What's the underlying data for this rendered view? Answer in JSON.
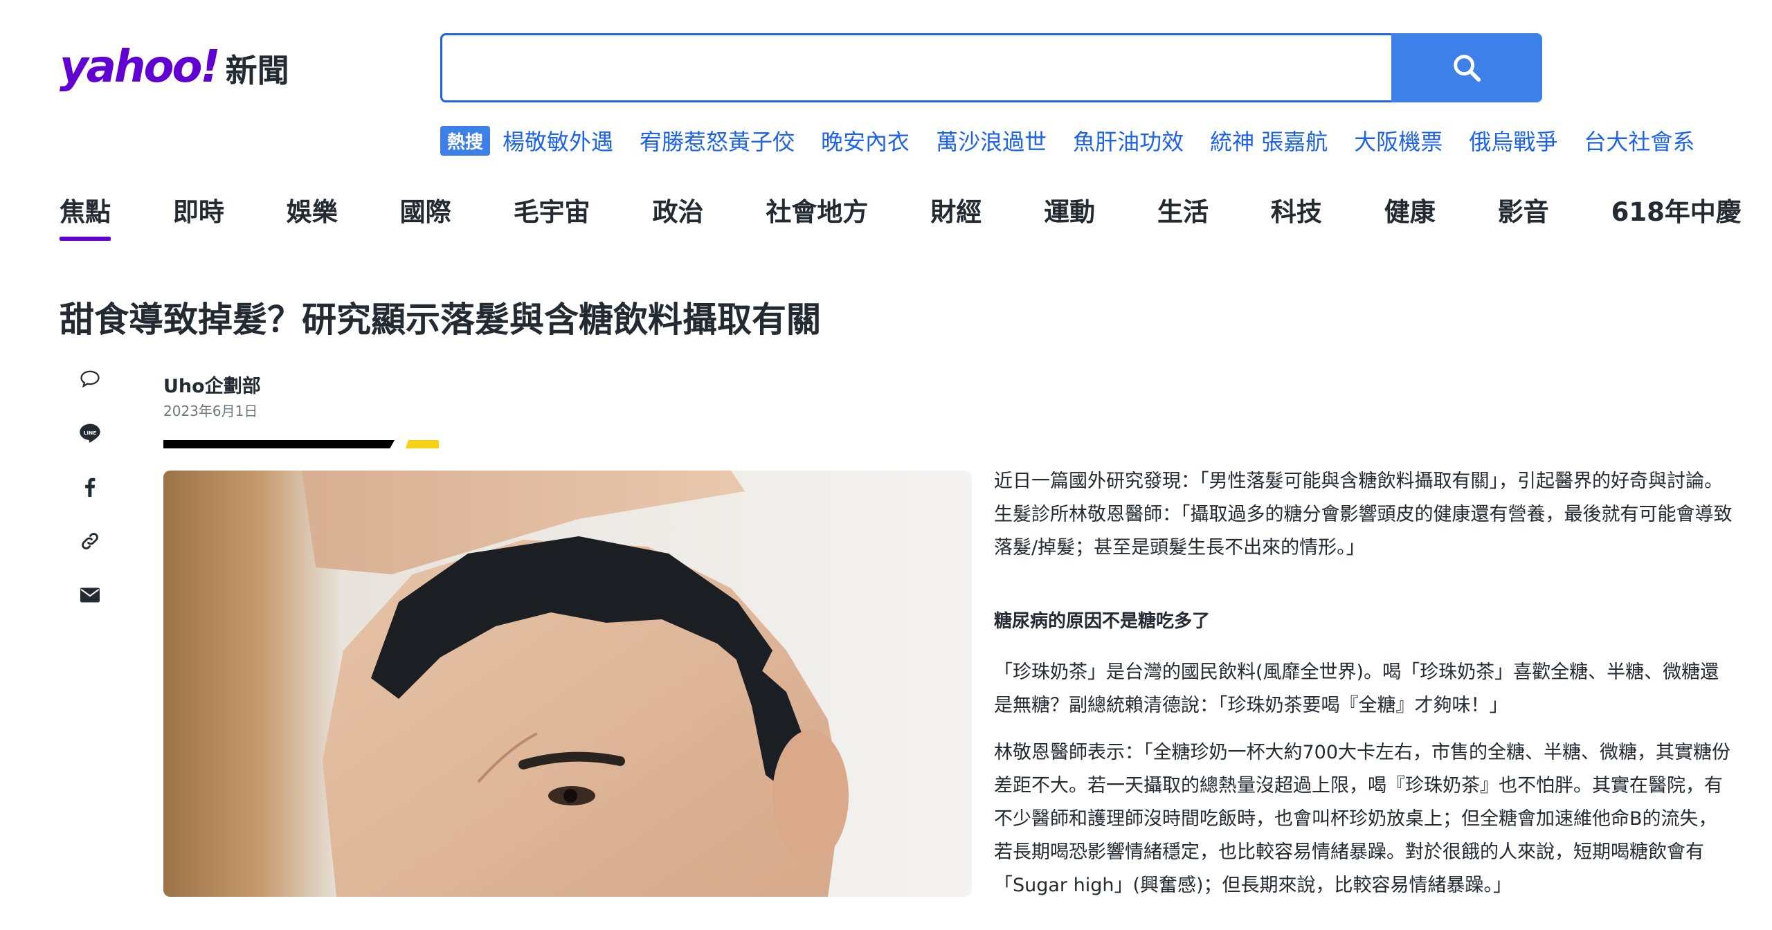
{
  "header": {
    "logo_text": "yahoo!",
    "section_name": "新聞",
    "search": {
      "placeholder": "",
      "value": ""
    },
    "search_icon": "search-icon",
    "trending_badge": "熱搜",
    "trending": [
      "楊敬敏外遇",
      "宥勝惹怒黃子佼",
      "晚安內衣",
      "萬沙浪過世",
      "魚肝油功效",
      "統神 張嘉航",
      "大阪機票",
      "俄烏戰爭",
      "台大社會系"
    ]
  },
  "nav": {
    "items": [
      "焦點",
      "即時",
      "娛樂",
      "國際",
      "毛宇宙",
      "政治",
      "社會地方",
      "財經",
      "運動",
      "生活",
      "科技",
      "健康",
      "影音",
      "618年中慶"
    ],
    "active_index": 0
  },
  "article": {
    "headline": "甜食導致掉髮？研究顯示落髮與含糖飲料攝取有關",
    "author": "Uho企劃部",
    "date": "2023年6月1日",
    "share_icons": [
      "comment-icon",
      "line-icon",
      "facebook-icon",
      "link-icon",
      "mail-icon"
    ],
    "paragraph_1": "近日一篇國外研究發現：「男性落髮可能與含糖飲料攝取有關」，引起醫界的好奇與討論。生髮診所林敬恩醫師：「攝取過多的糖分會影響頭皮的健康還有營養，最後就有可能會導致落髮/掉髮；甚至是頭髮生長不出來的情形。」",
    "subheading": "糖尿病的原因不是糖吃多了",
    "paragraph_2": "「珍珠奶茶」是台灣的國民飲料(風靡全世界)。喝「珍珠奶茶」喜歡全糖、半糖、微糖還是無糖？副總統賴清德說：「珍珠奶茶要喝『全糖』才夠味！」",
    "paragraph_3": "林敬恩醫師表示：「全糖珍奶一杯大約700大卡左右，市售的全糖、半糖、微糖，其實糖份差距不大。若一天攝取的總熱量沒超過上限，喝『珍珠奶茶』也不怕胖。其實在醫院，有不少醫師和護理師沒時間吃飯時，也會叫杯珍奶放桌上；但全糖會加速維他命B的流失，若長期喝恐影響情緒穩定，也比較容易情緒暴躁。對於很餓的人來說，短期喝糖飲會有「Sugar high」(興奮感)；但長期來說，比較容易情緒暴躁。」"
  },
  "colors": {
    "brand_purple": "#6001d2",
    "link_blue": "#1d62ed",
    "search_button": "#3d80ea",
    "accent_yellow": "#f7d117"
  }
}
